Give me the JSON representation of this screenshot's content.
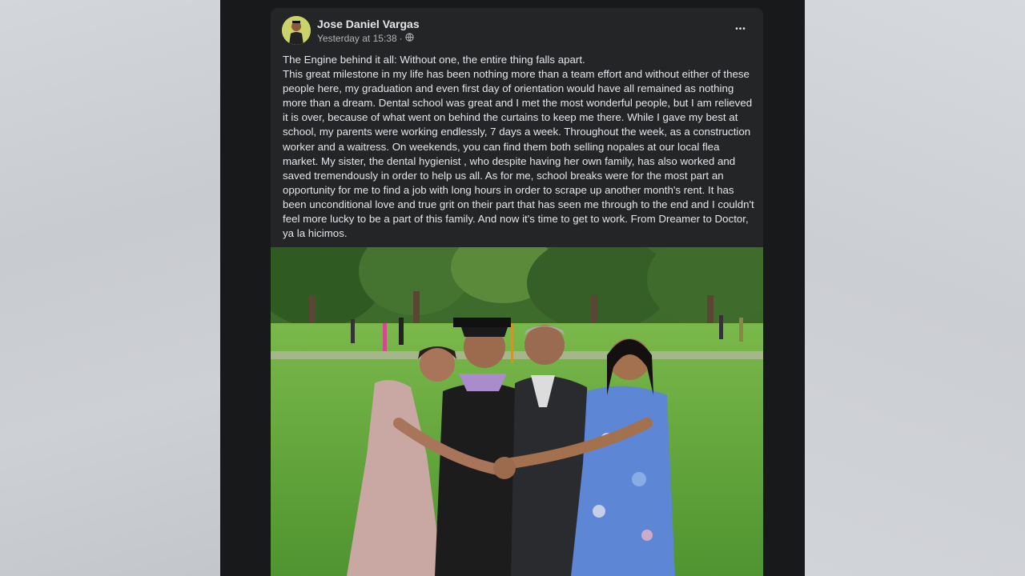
{
  "post": {
    "author": "Jose Daniel Vargas",
    "timestamp": "Yesterday at 15:38",
    "separator": "·",
    "privacy_icon": "globe-icon",
    "more_label": "•••",
    "text": "The Engine behind it all: Without one, the entire thing falls apart.\nThis great milestone in my life has been nothing more than a team effort and without either of these people here, my graduation and even first day of orientation would have all remained as nothing more than a dream. Dental school was great and I met the most wonderful people, but I am relieved it is over, because of what went on behind the curtains to keep me there. While I gave my best at school, my parents were working endlessly, 7 days a week. Throughout the week, as a construction worker and a waitress. On weekends, you can find them both selling nopales at our local flea market. My sister, the dental hygienist , who despite having her own family, has also worked and saved tremendously in order to help us all. As for me, school breaks were for the most part an opportunity for me to find a job with long hours in order to scrape up another month's rent. It has been unconditional love and true grit on their part that has seen me through to the end and I couldn't feel more lucky to be a part of this family. And now it's time to get to work. From Dreamer to Doctor, ya la hicimos."
  },
  "colors": {
    "page_bg": "#18191a",
    "card_bg": "#242526",
    "primary_text": "#e4e6eb",
    "secondary_text": "#b0b3b8",
    "grass": "#5fa03a"
  }
}
